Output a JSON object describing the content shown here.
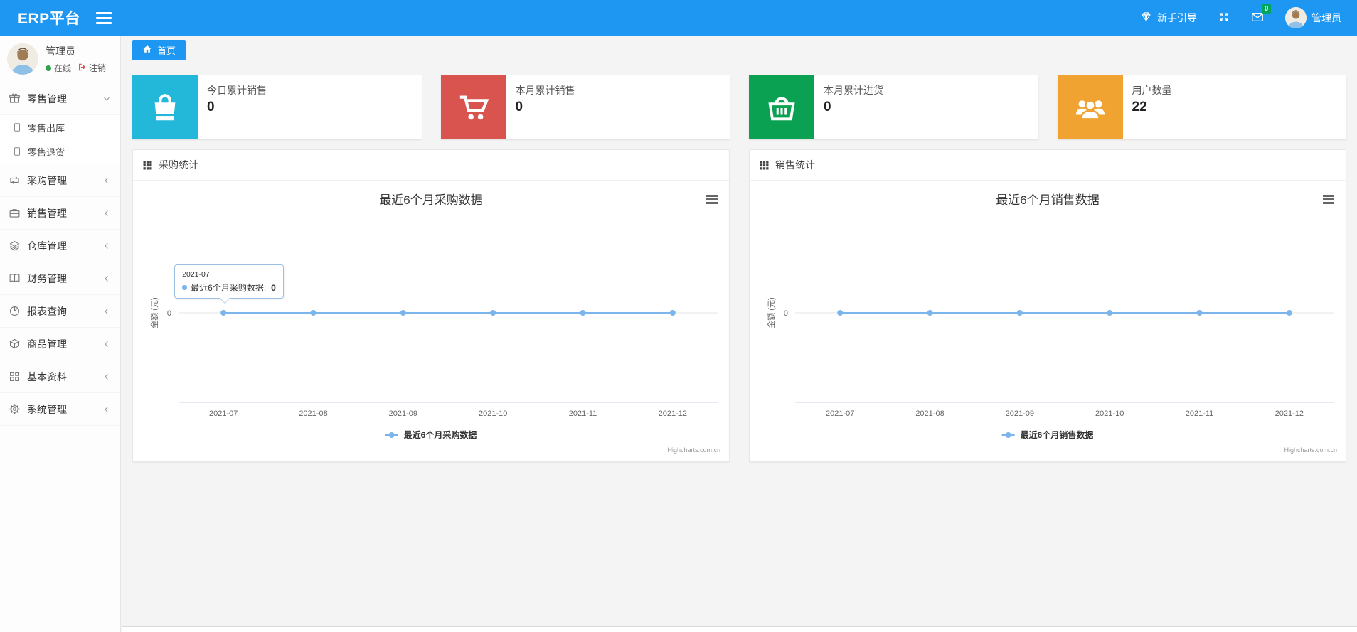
{
  "navbar": {
    "brand": "ERP平台",
    "guide_label": "新手引导",
    "message_count": "0",
    "user_name": "管理员"
  },
  "sidebar": {
    "user": {
      "name": "管理员",
      "status": "在线",
      "logout": "注销"
    },
    "menu": [
      {
        "label": "零售管理",
        "icon": "gift-icon",
        "state": "expanded",
        "children": [
          {
            "label": "零售出库",
            "icon": "file-icon"
          },
          {
            "label": "零售退货",
            "icon": "file-icon"
          }
        ]
      },
      {
        "label": "采购管理",
        "icon": "exchange-icon",
        "state": "collapsed"
      },
      {
        "label": "销售管理",
        "icon": "briefcase-icon",
        "state": "collapsed"
      },
      {
        "label": "仓库管理",
        "icon": "layers-icon",
        "state": "collapsed"
      },
      {
        "label": "财务管理",
        "icon": "book-icon",
        "state": "collapsed"
      },
      {
        "label": "报表查询",
        "icon": "pie-chart-icon",
        "state": "collapsed"
      },
      {
        "label": "商品管理",
        "icon": "box-icon",
        "state": "collapsed"
      },
      {
        "label": "基本资料",
        "icon": "grid-icon",
        "state": "collapsed"
      },
      {
        "label": "系统管理",
        "icon": "gear-icon",
        "state": "collapsed"
      }
    ]
  },
  "tabs": [
    {
      "label": "首页",
      "active": true
    }
  ],
  "stat_cards": [
    {
      "label": "今日累计销售",
      "value": "0",
      "icon": "shopping-bag-icon",
      "color": "#23b7d9"
    },
    {
      "label": "本月累计销售",
      "value": "0",
      "icon": "shopping-cart-icon",
      "color": "#d9534f"
    },
    {
      "label": "本月累计进货",
      "value": "0",
      "icon": "basket-icon",
      "color": "#0ba152"
    },
    {
      "label": "用户数量",
      "value": "22",
      "icon": "users-icon",
      "color": "#f0a330"
    }
  ],
  "panels": [
    {
      "title": "采购统计"
    },
    {
      "title": "销售统计"
    }
  ],
  "chart_data": [
    {
      "type": "line",
      "title": "最近6个月采购数据",
      "categories": [
        "2021-07",
        "2021-08",
        "2021-09",
        "2021-10",
        "2021-11",
        "2021-12"
      ],
      "series": [
        {
          "name": "最近6个月采购数据",
          "values": [
            0,
            0,
            0,
            0,
            0,
            0
          ]
        }
      ],
      "xlabel": "",
      "ylabel": "金额 (元)",
      "yticks": [
        "0"
      ],
      "grid": true,
      "legend_position": "bottom",
      "line_color": "#7cb5ec",
      "credit": "Highcharts.com.cn",
      "tooltip": {
        "visible": true,
        "header": "2021-07",
        "series_name": "最近6个月采购数据",
        "value": "0",
        "point_index": 0
      }
    },
    {
      "type": "line",
      "title": "最近6个月销售数据",
      "categories": [
        "2021-07",
        "2021-08",
        "2021-09",
        "2021-10",
        "2021-11",
        "2021-12"
      ],
      "series": [
        {
          "name": "最近6个月销售数据",
          "values": [
            0,
            0,
            0,
            0,
            0,
            0
          ]
        }
      ],
      "xlabel": "",
      "ylabel": "金额 (元)",
      "yticks": [
        "0"
      ],
      "grid": true,
      "legend_position": "bottom",
      "line_color": "#7cb5ec",
      "credit": "Highcharts.com.cn",
      "tooltip": {
        "visible": false
      }
    }
  ],
  "colors": {
    "accent_blue": "#1e97f3",
    "badge_green": "#00a65a",
    "status_green": "#30a14e",
    "logout_red": "#d9534f",
    "chart_line": "#7cb5ec"
  }
}
